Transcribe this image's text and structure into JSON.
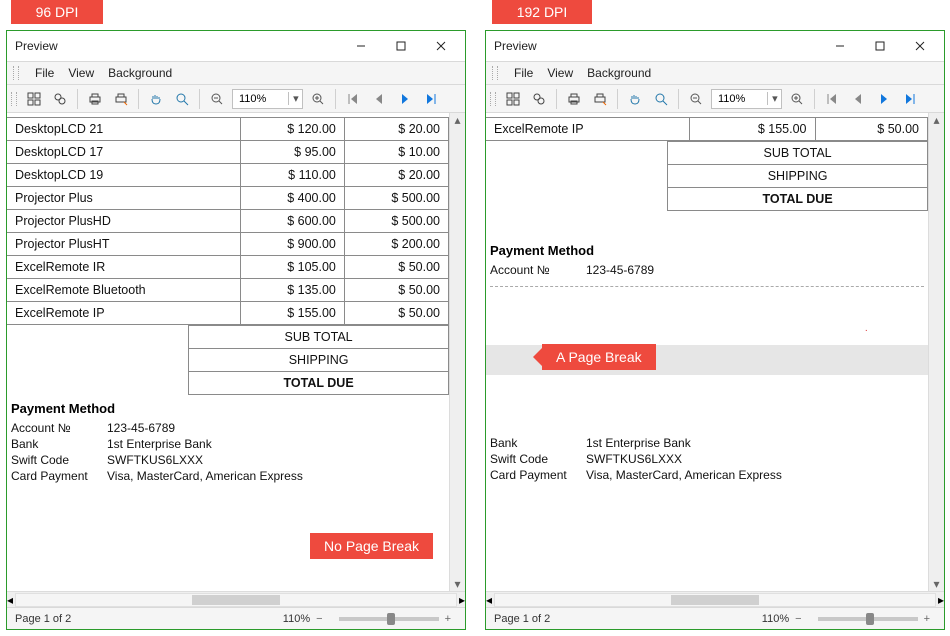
{
  "badges": {
    "left": "96 DPI",
    "right": "192 DPI"
  },
  "window": {
    "title": "Preview",
    "menu": {
      "file": "File",
      "view": "View",
      "background": "Background"
    },
    "zoom": "110%",
    "status": {
      "page": "Page 1 of 2",
      "zoom": "110%"
    }
  },
  "toolbar_icons": {
    "thumbs": "thumbnails-icon",
    "find": "find-icon",
    "print": "print-icon",
    "quickprint": "quick-print-icon",
    "hand": "hand-tool-icon",
    "mag": "magnifier-icon",
    "zoomout": "zoom-out-icon",
    "zoomin": "zoom-in-icon",
    "first": "first-page-icon",
    "prev": "prev-page-icon",
    "next": "next-page-icon",
    "last": "last-page-icon"
  },
  "left_rows": [
    {
      "name": "DesktopLCD 21",
      "c1": "$ 120.00",
      "c2": "$ 20.00"
    },
    {
      "name": "DesktopLCD 17",
      "c1": "$ 95.00",
      "c2": "$ 10.00"
    },
    {
      "name": "DesktopLCD 19",
      "c1": "$ 110.00",
      "c2": "$ 20.00"
    },
    {
      "name": "Projector Plus",
      "c1": "$ 400.00",
      "c2": "$ 500.00"
    },
    {
      "name": "Projector PlusHD",
      "c1": "$ 600.00",
      "c2": "$ 500.00"
    },
    {
      "name": "Projector PlusHT",
      "c1": "$ 900.00",
      "c2": "$ 200.00"
    },
    {
      "name": "ExcelRemote IR",
      "c1": "$ 105.00",
      "c2": "$ 50.00"
    },
    {
      "name": "ExcelRemote Bluetooth",
      "c1": "$ 135.00",
      "c2": "$ 50.00"
    },
    {
      "name": "ExcelRemote IP",
      "c1": "$ 155.00",
      "c2": "$ 50.00"
    }
  ],
  "right_rows": [
    {
      "name": "ExcelRemote IP",
      "c1": "$ 155.00",
      "c2": "$ 50.00"
    }
  ],
  "totals": {
    "sub": "SUB TOTAL",
    "ship": "SHIPPING",
    "due": "TOTAL DUE"
  },
  "payment": {
    "title": "Payment Method",
    "account_lbl": "Account №",
    "account": "123-45-6789",
    "bank_lbl": "Bank",
    "bank": "1st Enterprise Bank",
    "swift_lbl": "Swift Code",
    "swift": "SWFTKUS6LXXX",
    "card_lbl": "Card Payment",
    "card": "Visa, MasterCard, American Express"
  },
  "annot": {
    "left": "No Page Break",
    "right": "A Page Break"
  }
}
